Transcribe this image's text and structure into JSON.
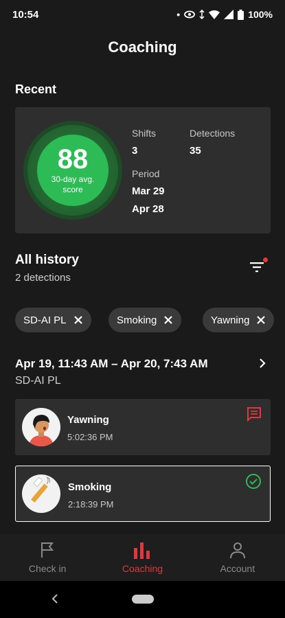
{
  "status": {
    "time": "10:54",
    "battery": "100%"
  },
  "header": {
    "title": "Coaching"
  },
  "recent": {
    "label": "Recent",
    "score": "88",
    "score_caption_line1": "30-day avg.",
    "score_caption_line2": "score",
    "shifts_label": "Shifts",
    "shifts_value": "3",
    "detections_label": "Detections",
    "detections_value": "35",
    "period_label": "Period",
    "period_start": "Mar 29",
    "period_end": "Apr 28"
  },
  "history": {
    "title": "All history",
    "subtitle": "2 detections",
    "chips": [
      {
        "label": "SD-AI PL"
      },
      {
        "label": "Smoking"
      },
      {
        "label": "Yawning"
      }
    ]
  },
  "shift": {
    "range": "Apr 19, 11:43 AM – Apr 20, 7:43 AM",
    "vehicle": "SD-AI PL"
  },
  "events": [
    {
      "title": "Yawning",
      "time": "5:02:36 PM",
      "icon": "comment-icon",
      "color": "#e0383e"
    },
    {
      "title": "Smoking",
      "time": "2:18:39 PM",
      "icon": "check-circle-icon",
      "color": "#2dbb55"
    }
  ],
  "nav": {
    "items": [
      {
        "label": "Check in",
        "icon": "flag-icon"
      },
      {
        "label": "Coaching",
        "icon": "bar-chart-icon"
      },
      {
        "label": "Account",
        "icon": "person-icon"
      }
    ]
  }
}
